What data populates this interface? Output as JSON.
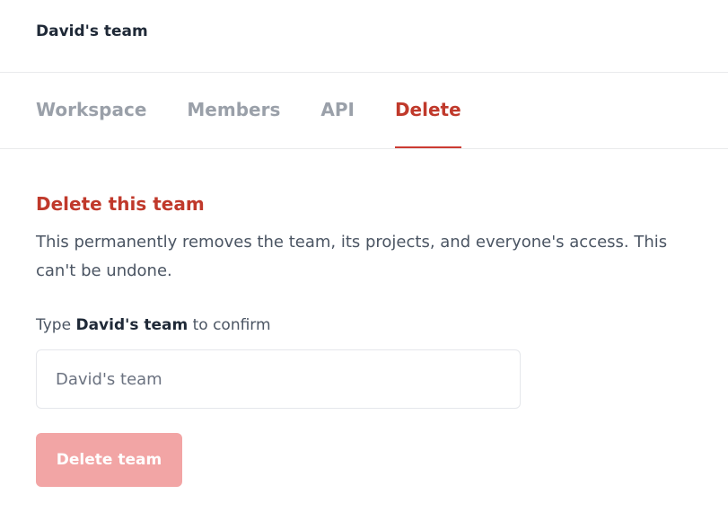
{
  "header": {
    "team_name": "David's team"
  },
  "tabs": [
    {
      "label": "Workspace"
    },
    {
      "label": "Members"
    },
    {
      "label": "API"
    },
    {
      "label": "Delete",
      "active": true
    }
  ],
  "delete_section": {
    "title": "Delete this team",
    "description": "This permanently removes the team, its projects, and everyone's access. This can't be undone.",
    "confirm_prefix": "Type",
    "confirm_team": "David's team",
    "confirm_suffix": "to confirm",
    "input_value": "David's team",
    "button_label": "Delete team",
    "button_disabled": true
  },
  "colors": {
    "accent": "#c0392b",
    "button_disabled_bg": "#f2a5a5",
    "tab_inactive": "#9aa0a9"
  }
}
